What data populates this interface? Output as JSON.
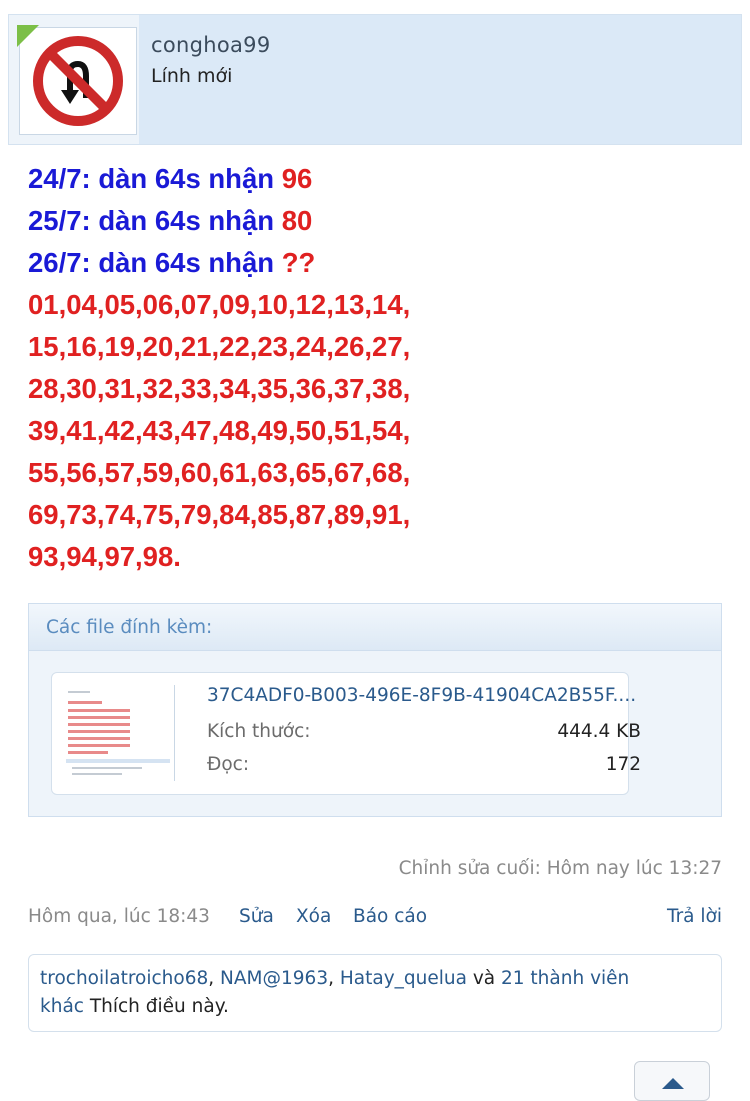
{
  "user": {
    "username": "conghoa99",
    "rank": "Lính mới",
    "avatar_icon": "no-u-turn-sign-icon"
  },
  "message": {
    "lines": [
      {
        "prefix": "24/7: dàn 64s nhận ",
        "value": "96"
      },
      {
        "prefix": "25/7: dàn 64s nhận ",
        "value": "80"
      },
      {
        "prefix": "26/7: dàn 64s nhận ",
        "value": "??"
      }
    ],
    "numbers": [
      "01,04,05,06,07,09,10,12,13,14,",
      "15,16,19,20,21,22,23,24,26,27,",
      "28,30,31,32,33,34,35,36,37,38,",
      "39,41,42,43,47,48,49,50,51,54,",
      "55,56,57,59,60,61,63,65,67,68,",
      "69,73,74,75,79,84,85,87,89,91,",
      "93,94,97,98."
    ],
    "colors": {
      "blue": "#1a1ad6",
      "red": "#e02121"
    }
  },
  "attachments": {
    "title": "Các file đính kèm:",
    "file": {
      "name": "37C4ADF0-B003-496E-8F9B-41904CA2B55F....",
      "size_label": "Kích thước:",
      "size_value": "444.4 KB",
      "views_label": "Đọc:",
      "views_value": "172"
    }
  },
  "footer": {
    "edited": "Chỉnh sửa cuối: Hôm nay lúc 13:27",
    "date": "Hôm qua, lúc 18:43",
    "edit_link": "Sửa",
    "delete_link": "Xóa",
    "report_link": "Báo cáo",
    "reply_link": "Trả lời"
  },
  "likes": {
    "user1": "trochoilatroicho68",
    "sep1": ", ",
    "user2": "NAM@1963",
    "sep2": ", ",
    "user3": "Hatay_quelua",
    "and": " và ",
    "others_1": "21 thành viên",
    "others_2": "khác",
    "suffix": " Thích điều này."
  }
}
